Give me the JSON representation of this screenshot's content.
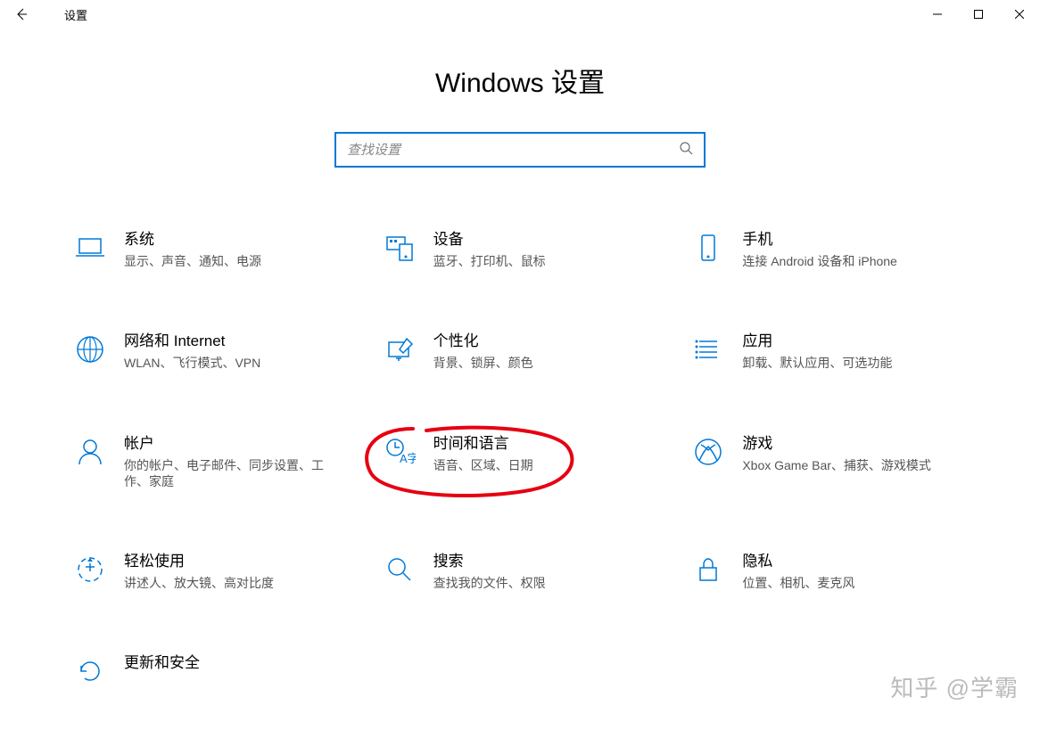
{
  "window": {
    "title": "设置"
  },
  "page": {
    "heading": "Windows 设置"
  },
  "search": {
    "placeholder": "查找设置"
  },
  "categories": [
    {
      "id": "system",
      "title": "系统",
      "desc": "显示、声音、通知、电源"
    },
    {
      "id": "devices",
      "title": "设备",
      "desc": "蓝牙、打印机、鼠标"
    },
    {
      "id": "phone",
      "title": "手机",
      "desc": "连接 Android 设备和 iPhone"
    },
    {
      "id": "network",
      "title": "网络和 Internet",
      "desc": "WLAN、飞行模式、VPN"
    },
    {
      "id": "personalize",
      "title": "个性化",
      "desc": "背景、锁屏、颜色"
    },
    {
      "id": "apps",
      "title": "应用",
      "desc": "卸载、默认应用、可选功能"
    },
    {
      "id": "accounts",
      "title": "帐户",
      "desc": "你的帐户、电子邮件、同步设置、工作、家庭"
    },
    {
      "id": "time-language",
      "title": "时间和语言",
      "desc": "语音、区域、日期"
    },
    {
      "id": "gaming",
      "title": "游戏",
      "desc": "Xbox Game Bar、捕获、游戏模式"
    },
    {
      "id": "ease",
      "title": "轻松使用",
      "desc": "讲述人、放大镜、高对比度"
    },
    {
      "id": "search",
      "title": "搜索",
      "desc": "查找我的文件、权限"
    },
    {
      "id": "privacy",
      "title": "隐私",
      "desc": "位置、相机、麦克风"
    },
    {
      "id": "update",
      "title": "更新和安全",
      "desc": ""
    }
  ],
  "watermark": "知乎 @学霸"
}
